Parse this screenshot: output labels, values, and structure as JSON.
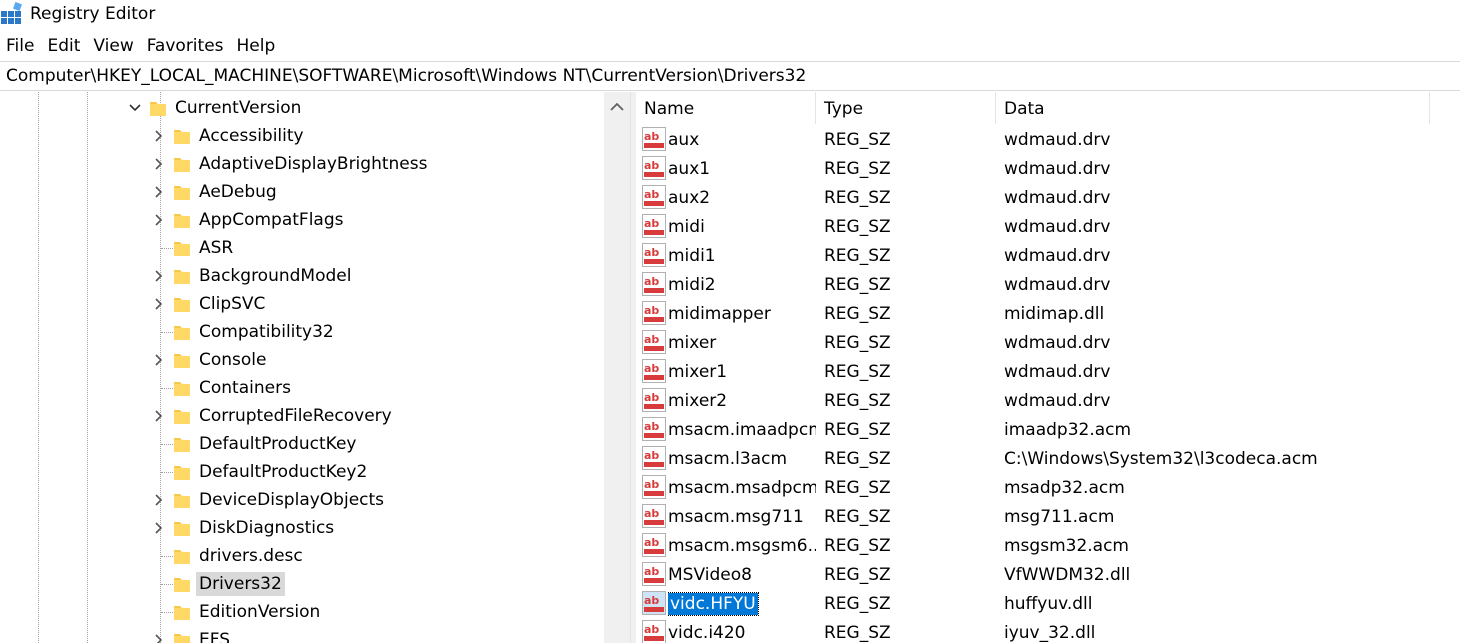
{
  "window": {
    "title": "Registry Editor"
  },
  "menu": [
    "File",
    "Edit",
    "View",
    "Favorites",
    "Help"
  ],
  "address": "Computer\\HKEY_LOCAL_MACHINE\\SOFTWARE\\Microsoft\\Windows NT\\CurrentVersion\\Drivers32",
  "icons": {
    "app": "registry-editor-icon",
    "folder": "folder-icon",
    "value": "string-value-icon",
    "expand": "chevron-right-icon",
    "collapse": "chevron-down-icon",
    "scroll_up": "scroll-up-arrow-icon"
  },
  "colors": {
    "selection": "#0078d7",
    "tree_selection": "#d9d9d9",
    "folder": "#f8c84a",
    "value_icon": "#d83b3b"
  },
  "tree": {
    "parent": {
      "label": "CurrentVersion",
      "expanded": true
    },
    "children": [
      {
        "label": "Accessibility",
        "expandable": true
      },
      {
        "label": "AdaptiveDisplayBrightness",
        "expandable": true
      },
      {
        "label": "AeDebug",
        "expandable": true
      },
      {
        "label": "AppCompatFlags",
        "expandable": true
      },
      {
        "label": "ASR",
        "expandable": false
      },
      {
        "label": "BackgroundModel",
        "expandable": true
      },
      {
        "label": "ClipSVC",
        "expandable": true
      },
      {
        "label": "Compatibility32",
        "expandable": false
      },
      {
        "label": "Console",
        "expandable": true
      },
      {
        "label": "Containers",
        "expandable": false
      },
      {
        "label": "CorruptedFileRecovery",
        "expandable": true
      },
      {
        "label": "DefaultProductKey",
        "expandable": false
      },
      {
        "label": "DefaultProductKey2",
        "expandable": false
      },
      {
        "label": "DeviceDisplayObjects",
        "expandable": true
      },
      {
        "label": "DiskDiagnostics",
        "expandable": true
      },
      {
        "label": "drivers.desc",
        "expandable": false
      },
      {
        "label": "Drivers32",
        "expandable": false,
        "selected": true
      },
      {
        "label": "EditionVersion",
        "expandable": false
      },
      {
        "label": "EFS",
        "expandable": true
      }
    ]
  },
  "list": {
    "columns": [
      "Name",
      "Type",
      "Data"
    ],
    "rows": [
      {
        "name": "aux",
        "type": "REG_SZ",
        "data": "wdmaud.drv"
      },
      {
        "name": "aux1",
        "type": "REG_SZ",
        "data": "wdmaud.drv"
      },
      {
        "name": "aux2",
        "type": "REG_SZ",
        "data": "wdmaud.drv"
      },
      {
        "name": "midi",
        "type": "REG_SZ",
        "data": "wdmaud.drv"
      },
      {
        "name": "midi1",
        "type": "REG_SZ",
        "data": "wdmaud.drv"
      },
      {
        "name": "midi2",
        "type": "REG_SZ",
        "data": "wdmaud.drv"
      },
      {
        "name": "midimapper",
        "type": "REG_SZ",
        "data": "midimap.dll"
      },
      {
        "name": "mixer",
        "type": "REG_SZ",
        "data": "wdmaud.drv"
      },
      {
        "name": "mixer1",
        "type": "REG_SZ",
        "data": "wdmaud.drv"
      },
      {
        "name": "mixer2",
        "type": "REG_SZ",
        "data": "wdmaud.drv"
      },
      {
        "name": "msacm.imaadpcm",
        "type": "REG_SZ",
        "data": "imaadp32.acm"
      },
      {
        "name": "msacm.l3acm",
        "type": "REG_SZ",
        "data": "C:\\Windows\\System32\\l3codeca.acm"
      },
      {
        "name": "msacm.msadpcm",
        "type": "REG_SZ",
        "data": "msadp32.acm"
      },
      {
        "name": "msacm.msg711",
        "type": "REG_SZ",
        "data": "msg711.acm"
      },
      {
        "name": "msacm.msgsm6...",
        "type": "REG_SZ",
        "data": "msgsm32.acm"
      },
      {
        "name": "MSVideo8",
        "type": "REG_SZ",
        "data": "VfWWDM32.dll"
      },
      {
        "name": "vidc.HFYU",
        "type": "REG_SZ",
        "data": "huffyuv.dll",
        "selected": true
      },
      {
        "name": "vidc.i420",
        "type": "REG_SZ",
        "data": "iyuv_32.dll"
      }
    ]
  }
}
